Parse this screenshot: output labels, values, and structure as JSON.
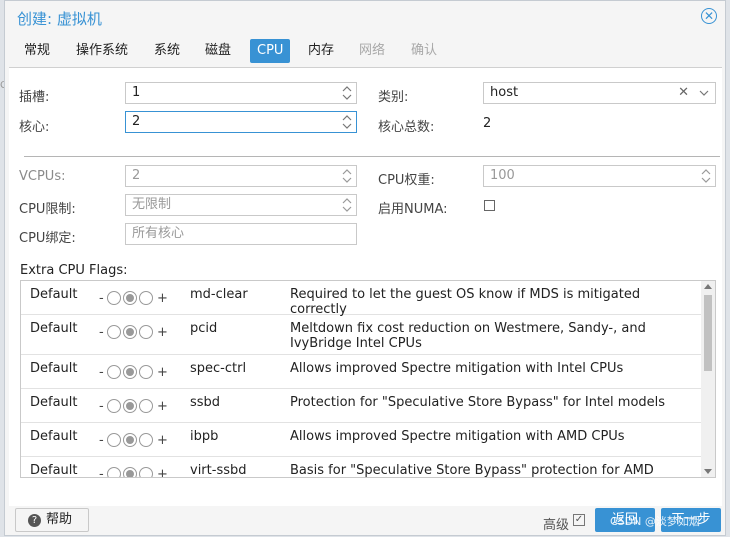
{
  "dialog": {
    "title": "创建: 虚拟机",
    "close_icon": "close-icon",
    "accent_color": "#3892d4"
  },
  "tabs": [
    {
      "label": "常规",
      "state": "normal"
    },
    {
      "label": "操作系统",
      "state": "normal"
    },
    {
      "label": "系统",
      "state": "normal"
    },
    {
      "label": "磁盘",
      "state": "normal"
    },
    {
      "label": "CPU",
      "state": "active"
    },
    {
      "label": "内存",
      "state": "normal"
    },
    {
      "label": "网络",
      "state": "disabled"
    },
    {
      "label": "确认",
      "state": "disabled"
    }
  ],
  "form": {
    "sockets_label": "插槽:",
    "sockets_value": "1",
    "cores_label": "核心:",
    "cores_value": "2",
    "type_label": "类别:",
    "type_value": "host",
    "total_cores_label": "核心总数:",
    "total_cores_value": "2",
    "vcpus_label": "VCPUs:",
    "vcpus_value": "2",
    "cpu_limit_label": "CPU限制:",
    "cpu_limit_value": "无限制",
    "cpu_affinity_label": "CPU绑定:",
    "cpu_affinity_placeholder": "所有核心",
    "cpu_weight_label": "CPU权重:",
    "cpu_weight_value": "100",
    "numa_label": "启用NUMA:",
    "numa_checked": false
  },
  "flags": {
    "label": "Extra CPU Flags:",
    "rows": [
      {
        "state": "Default",
        "minus": "-",
        "plus": "+",
        "name": "md-clear",
        "desc": "Required to let the guest OS know if MDS is mitigated correctly"
      },
      {
        "state": "Default",
        "minus": "-",
        "plus": "+",
        "name": "pcid",
        "desc": "Meltdown fix cost reduction on Westmere, Sandy-, and IvyBridge Intel CPUs"
      },
      {
        "state": "Default",
        "minus": "-",
        "plus": "+",
        "name": "spec-ctrl",
        "desc": "Allows improved Spectre mitigation with Intel CPUs"
      },
      {
        "state": "Default",
        "minus": "-",
        "plus": "+",
        "name": "ssbd",
        "desc": "Protection for \"Speculative Store Bypass\" for Intel models"
      },
      {
        "state": "Default",
        "minus": "-",
        "plus": "+",
        "name": "ibpb",
        "desc": "Allows improved Spectre mitigation with AMD CPUs"
      },
      {
        "state": "Default",
        "minus": "-",
        "plus": "+",
        "name": "virt-ssbd",
        "desc": "Basis for \"Speculative Store Bypass\" protection for AMD models"
      }
    ]
  },
  "footer": {
    "help_label": "帮助",
    "advanced_label": "高级",
    "advanced_checked": true,
    "back_label": "返回",
    "next_label": "下一步"
  },
  "watermark": "CSDN @淡梦如烟"
}
